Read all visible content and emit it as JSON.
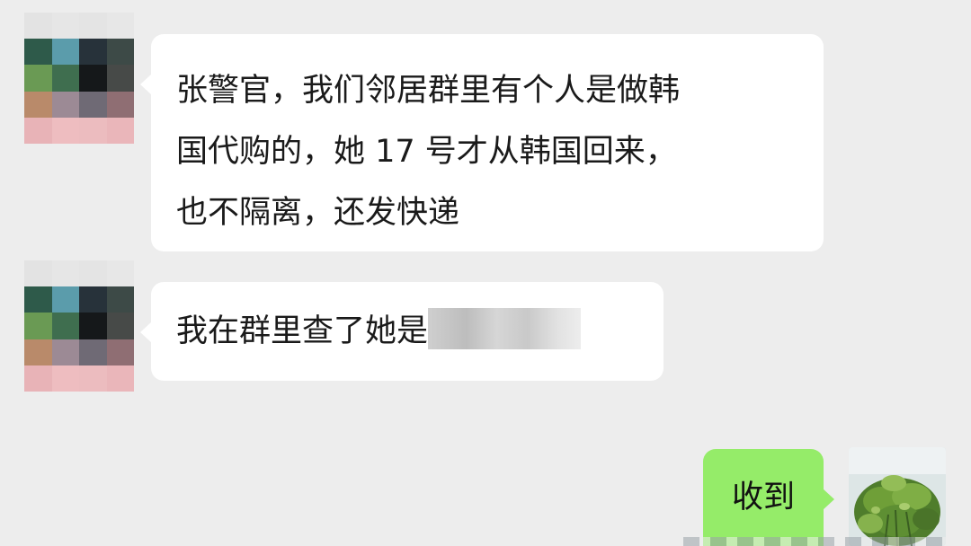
{
  "messages": [
    {
      "sender": "contact",
      "lines": [
        "张警官，我们邻居群里有个人是做韩",
        "国代购的，她 17 号才从韩国回来，",
        "也不隔离，还发快递"
      ]
    },
    {
      "sender": "contact",
      "text": "我在群里查了她是"
    },
    {
      "sender": "me",
      "text": "收到"
    }
  ],
  "colors": {
    "background": "#ededed",
    "incoming_bubble": "#ffffff",
    "outgoing_bubble": "#95ec69",
    "text": "#1a1a1a"
  },
  "icons": {
    "contact_avatar": "pixelated-avatar-icon",
    "my_avatar": "plant-photo-avatar",
    "redaction": "mosaic-redaction"
  }
}
